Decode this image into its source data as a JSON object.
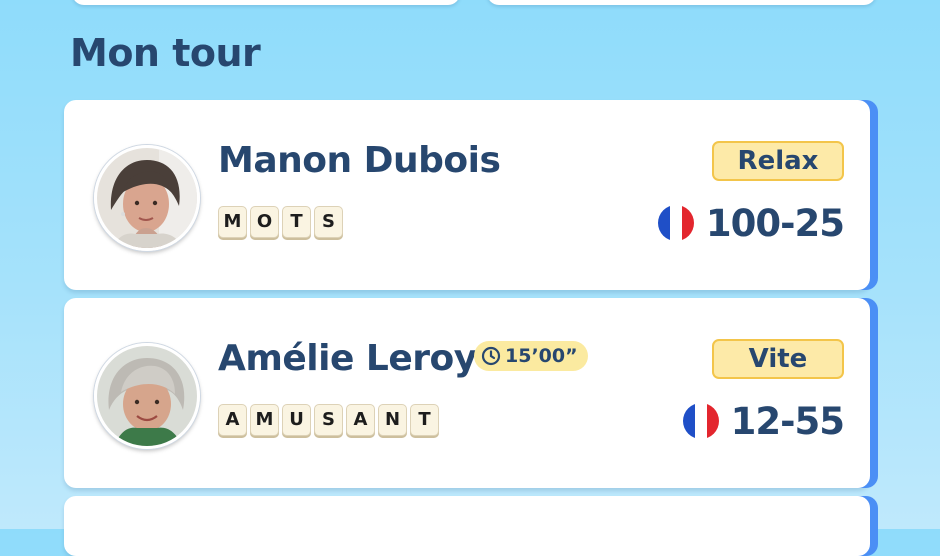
{
  "section": {
    "title": "Mon tour"
  },
  "games": [
    {
      "player": "Manon Dubois",
      "word_tiles": [
        "M",
        "O",
        "T",
        "S"
      ],
      "mode": "Relax",
      "score": "100-25",
      "flag": "france-flag-icon"
    },
    {
      "player": "Amélie Leroy",
      "timer": "15’00”",
      "word_tiles": [
        "A",
        "M",
        "U",
        "S",
        "A",
        "N",
        "T"
      ],
      "mode": "Vite",
      "score": "12-55",
      "flag": "france-flag-icon"
    }
  ],
  "colors": {
    "title_text": "#27476f",
    "card_accent": "#4b8ff5",
    "mode_badge_fill": "#fdeaa8",
    "mode_badge_border": "#f3c54a",
    "timer_badge_fill": "#fbeaa0",
    "tile_fill": "#faf4e2",
    "background_top": "#8fdcfb",
    "background_bottom": "#bfe9fc"
  }
}
